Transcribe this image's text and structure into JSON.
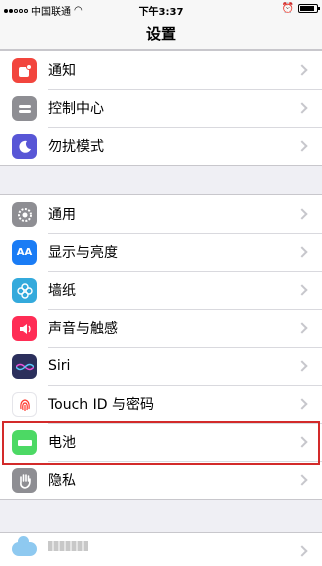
{
  "status_bar": {
    "carrier": "中国联通",
    "time": "下午3:37"
  },
  "nav": {
    "title": "设置"
  },
  "group1": [
    {
      "label": "通知",
      "icon": "notifications-icon",
      "color": "#f2453d"
    },
    {
      "label": "控制中心",
      "icon": "control-center-icon",
      "color": "#8e8e93"
    },
    {
      "label": "勿扰模式",
      "icon": "moon-icon",
      "color": "#5856d6"
    }
  ],
  "group2": [
    {
      "label": "通用",
      "icon": "gear-icon",
      "color": "#8e8e93"
    },
    {
      "label": "显示与亮度",
      "icon": "display-icon",
      "color": "#1a7cf5",
      "glyph": "AA"
    },
    {
      "label": "墙纸",
      "icon": "wallpaper-icon",
      "color": "#34aadc"
    },
    {
      "label": "声音与触感",
      "icon": "sound-icon",
      "color": "#ff2d55"
    },
    {
      "label": "Siri",
      "icon": "siri-icon",
      "color": "#2b2f5c"
    },
    {
      "label": "Touch ID 与密码",
      "icon": "fingerprint-icon",
      "color": "#ff3b30"
    },
    {
      "label": "电池",
      "icon": "battery-icon",
      "color": "#4cd964"
    },
    {
      "label": "隐私",
      "icon": "privacy-hand-icon",
      "color": "#8e8e93"
    }
  ],
  "highlight_color": "#d32a2a"
}
